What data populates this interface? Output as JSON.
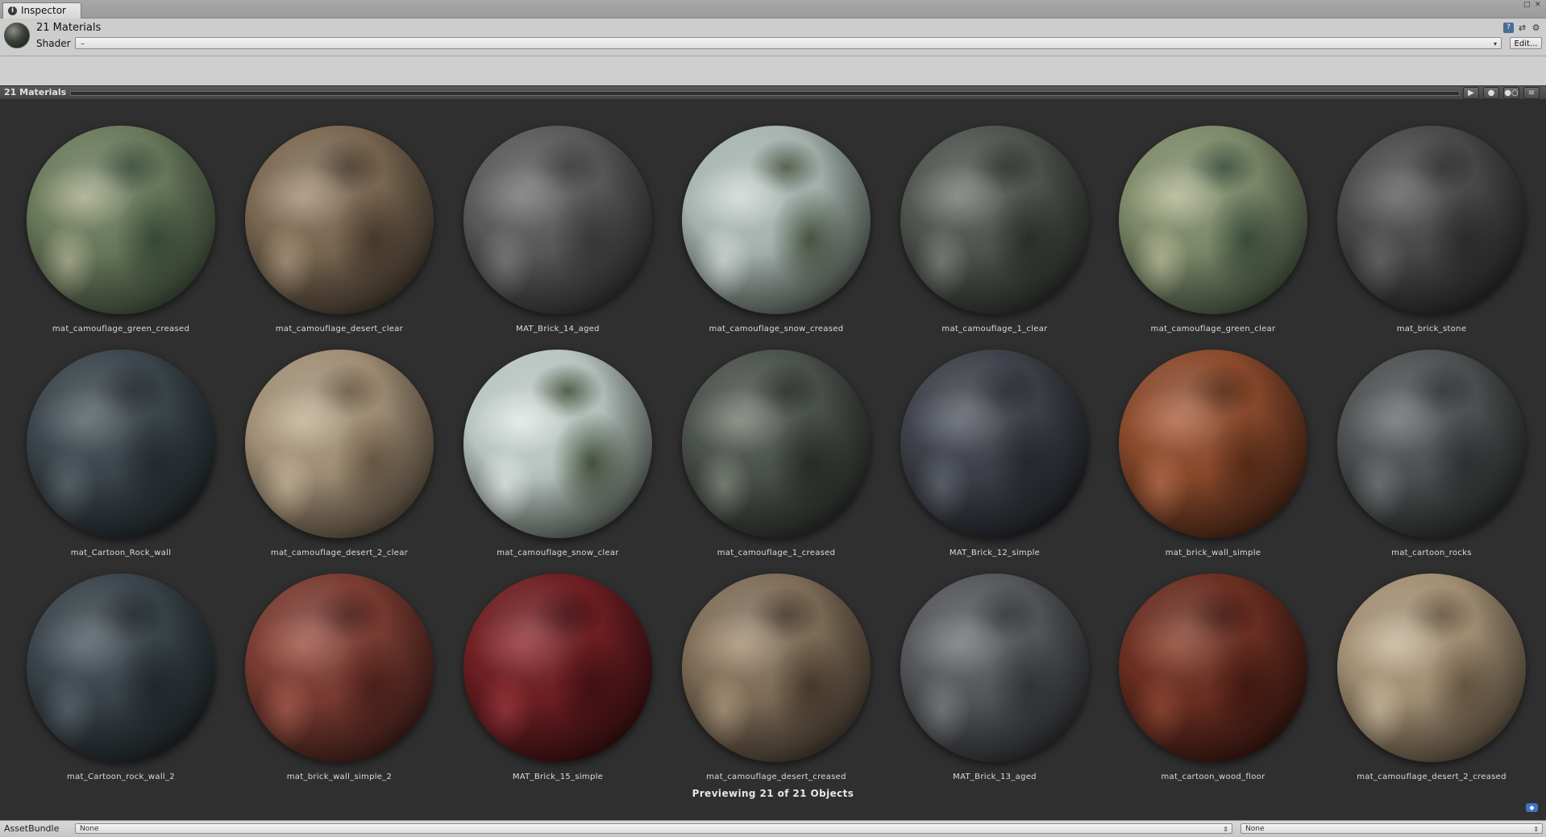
{
  "window": {
    "tab_title": "Inspector"
  },
  "header": {
    "title": "21 Materials",
    "shader_label": "Shader",
    "shader_value": "–",
    "edit_label": "Edit..."
  },
  "preview": {
    "title": "21 Materials",
    "status": "Previewing 21 of 21 Objects"
  },
  "materials": [
    {
      "name": "mat_camouflage_green_creased",
      "colors": [
        "#6b7a5c",
        "#3b4f3a",
        "#a9ad8c",
        "#2c3a2c"
      ]
    },
    {
      "name": "mat_camouflage_desert_clear",
      "colors": [
        "#7b6852",
        "#4c3e30",
        "#a89279",
        "#2a241c"
      ]
    },
    {
      "name": "MAT_Brick_14_aged",
      "colors": [
        "#5a5a5a",
        "#3c3c3c",
        "#7a7a7a",
        "#1e1e1e"
      ]
    },
    {
      "name": "mat_camouflage_snow_creased",
      "colors": [
        "#a7b4b0",
        "#4f5a48",
        "#d2dad6",
        "#2e3329"
      ]
    },
    {
      "name": "mat_camouflage_1_clear",
      "colors": [
        "#505550",
        "#2d322d",
        "#7a8078",
        "#191b18"
      ]
    },
    {
      "name": "mat_camouflage_green_clear",
      "colors": [
        "#7e8a6a",
        "#3d513d",
        "#b5b895",
        "#2b382b"
      ]
    },
    {
      "name": "mat_brick_stone",
      "colors": [
        "#4a4a4a",
        "#2e2e2e",
        "#656565",
        "#151515"
      ]
    },
    {
      "name": "mat_Cartoon_Rock_wall",
      "colors": [
        "#3c464c",
        "#262d31",
        "#59656b",
        "#121618"
      ]
    },
    {
      "name": "mat_camouflage_desert_2_clear",
      "colors": [
        "#a18f76",
        "#6e5c48",
        "#c4b297",
        "#3b3127"
      ]
    },
    {
      "name": "mat_camouflage_snow_clear",
      "colors": [
        "#b9c5c1",
        "#4a5742",
        "#e1e8e5",
        "#2d3329"
      ]
    },
    {
      "name": "mat_camouflage_1_creased",
      "colors": [
        "#4c524c",
        "#2a2f2a",
        "#7b8378",
        "#171917"
      ]
    },
    {
      "name": "MAT_Brick_12_simple",
      "colors": [
        "#3e4149",
        "#272a30",
        "#5e636c",
        "#121317"
      ]
    },
    {
      "name": "mat_brick_wall_simple",
      "colors": [
        "#8a4a2c",
        "#5a2d18",
        "#b0694a",
        "#2b140b"
      ]
    },
    {
      "name": "mat_cartoon_rocks",
      "colors": [
        "#4e5252",
        "#303434",
        "#6f7474",
        "#161818"
      ]
    },
    {
      "name": "mat_Cartoon_rock_wall_2",
      "colors": [
        "#3a444a",
        "#232a2e",
        "#56626a",
        "#111416"
      ]
    },
    {
      "name": "mat_brick_wall_simple_2",
      "colors": [
        "#7a3c32",
        "#4f221c",
        "#a2584c",
        "#25100d"
      ]
    },
    {
      "name": "MAT_Brick_15_simple",
      "colors": [
        "#6e1f22",
        "#461013",
        "#96353a",
        "#200709"
      ]
    },
    {
      "name": "mat_camouflage_desert_creased",
      "colors": [
        "#7f6d58",
        "#4b3d2f",
        "#a99479",
        "#2a231b"
      ]
    },
    {
      "name": "MAT_Brick_13_aged",
      "colors": [
        "#55575a",
        "#35373a",
        "#787b7e",
        "#1a1b1c"
      ]
    },
    {
      "name": "mat_cartoon_wood_floor",
      "colors": [
        "#6b2f22",
        "#441a12",
        "#8e4634",
        "#200b07"
      ]
    },
    {
      "name": "mat_camouflage_desert_2_creased",
      "colors": [
        "#a28f74",
        "#6b5944",
        "#c9b79c",
        "#3a3126"
      ]
    }
  ],
  "bottom_bar": {
    "label": "AssetBundle",
    "bundle_value": "None",
    "variant_value": "None"
  }
}
